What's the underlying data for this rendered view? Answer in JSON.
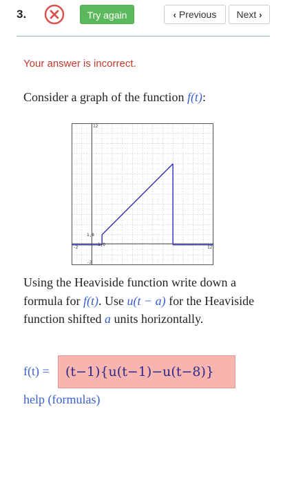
{
  "question": {
    "number": "3.",
    "status_icon": "x-circle-icon",
    "try_again_label": "Try again",
    "previous_label": "Previous",
    "next_label": "Next"
  },
  "feedback": {
    "message": "Your answer is incorrect."
  },
  "prompt": {
    "text_before": "Consider a graph of the function",
    "function": "f(t)",
    "text_after": ":"
  },
  "graph": {
    "tick_labels": {
      "y_top": "12",
      "y_mid": "1,8",
      "x_mid": "1,0",
      "x_left": "-2",
      "x_right": "12",
      "y_bottom": "-2"
    },
    "segments": [
      {
        "x": [
          -2,
          1
        ],
        "y": [
          0,
          0
        ]
      },
      {
        "x": [
          1,
          1
        ],
        "y": [
          0,
          1
        ]
      },
      {
        "x": [
          1,
          8
        ],
        "y": [
          1,
          8
        ]
      },
      {
        "x": [
          8,
          8
        ],
        "y": [
          8,
          0
        ]
      },
      {
        "x": [
          8,
          12
        ],
        "y": [
          0,
          0
        ]
      }
    ]
  },
  "instructions": {
    "p1": "Using the Heaviside function write down a formula for",
    "f": "f(t)",
    "p2": ". Use",
    "u": "u(t − a)",
    "p3": "for the Heaviside function shifted",
    "a": "a",
    "p4": "units horizontally."
  },
  "answer": {
    "label": "f(t) =",
    "value": "(t−1){u(t−1)−u(t−8)}"
  },
  "help_link": "help (formulas)",
  "colors": {
    "accent_green": "#5cb85c",
    "error_red": "#c0392b",
    "math_blue": "#3a5fcd",
    "answer_bg": "#f8b4ae",
    "graph_line": "#2b2bb8"
  }
}
